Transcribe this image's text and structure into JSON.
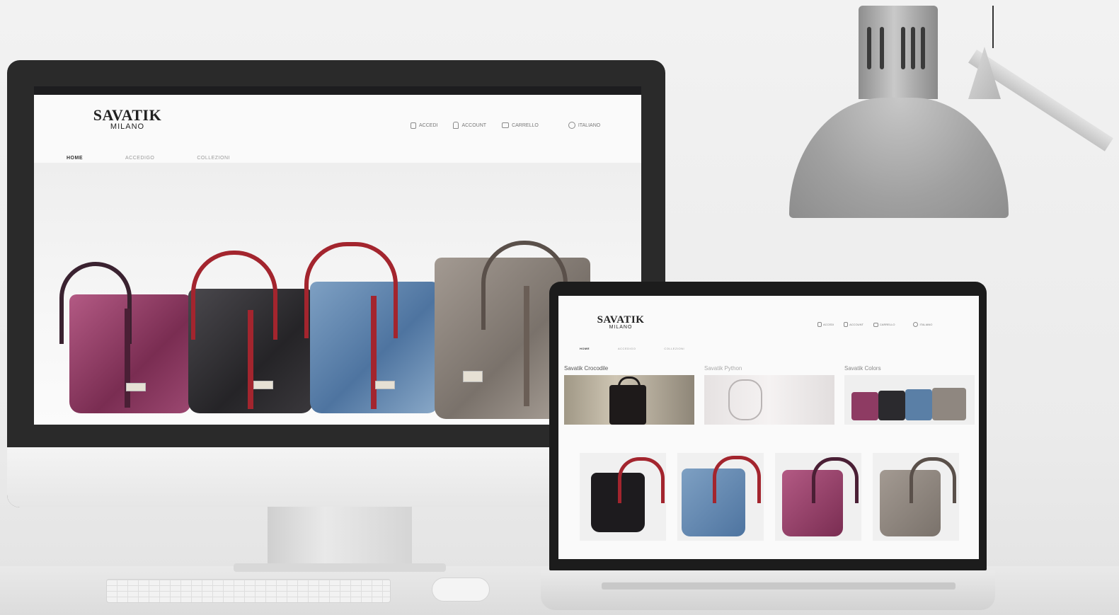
{
  "site": {
    "brand": "SAVATIK",
    "city": "MILANO",
    "utility": [
      "ACCEDI",
      "ACCOUNT",
      "CARRELLO",
      "ITALIANO"
    ],
    "nav": [
      "HOME",
      "ACCEDIGO",
      "COLLEZIONI"
    ]
  },
  "laptop": {
    "categories": [
      "Savatik Crocodile",
      "Savatik Python",
      "Savatik Colors"
    ]
  },
  "colors": {
    "bag_pink": "#8e3b63",
    "bag_dark": "#2b2a2e",
    "bag_blue": "#5a7fa6",
    "bag_grey": "#8f8780",
    "strap_red": "#a3252e"
  },
  "icons": {
    "accedi": "lock-icon",
    "account": "user-icon",
    "carrello": "cart-icon",
    "lingua": "globe-icon"
  }
}
